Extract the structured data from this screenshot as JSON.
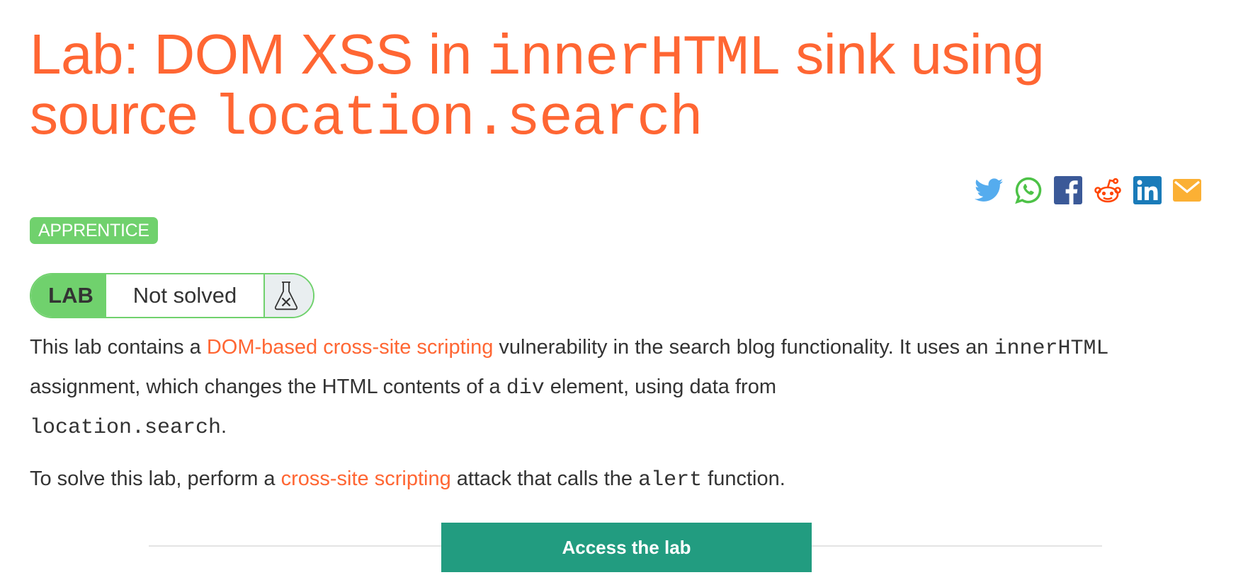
{
  "title": {
    "part1": "Lab: DOM XSS in ",
    "code1": "innerHTML",
    "part2": " sink using source ",
    "code2": "location.search"
  },
  "share": {
    "items": [
      {
        "name": "twitter",
        "icon": "twitter-icon",
        "color": "#55acee"
      },
      {
        "name": "whatsapp",
        "icon": "whatsapp-icon",
        "color": "#4dc247"
      },
      {
        "name": "facebook",
        "icon": "facebook-icon",
        "color": "#3b5998"
      },
      {
        "name": "reddit",
        "icon": "reddit-icon",
        "color": "#ff4500"
      },
      {
        "name": "linkedin",
        "icon": "linkedin-icon",
        "color": "#1a7bb9"
      },
      {
        "name": "email",
        "icon": "email-icon",
        "color": "#fbb034"
      }
    ]
  },
  "level_badge": "APPRENTICE",
  "lab_status": {
    "label": "LAB",
    "status": "Not solved",
    "icon": "flask-x-icon"
  },
  "description": {
    "p1": {
      "t1": "This lab contains a ",
      "link1": "DOM-based cross-site scripting",
      "t2": " vulnerability in the search blog functionality. It uses an ",
      "code1": "innerHTML",
      "t3": " assignment, which changes the HTML contents of a ",
      "code2": "div",
      "t4": " element, using data from ",
      "code3": "location.search",
      "t5": "."
    },
    "p2": {
      "t1": "To solve this lab, perform a ",
      "link1": "cross-site scripting",
      "t2": " attack that calls the ",
      "code1": "alert",
      "t3": " function."
    }
  },
  "access_button": "Access the lab",
  "colors": {
    "accent": "#ff6633",
    "badge_green": "#70d16d",
    "button_teal": "#229c80",
    "text": "#333333"
  }
}
